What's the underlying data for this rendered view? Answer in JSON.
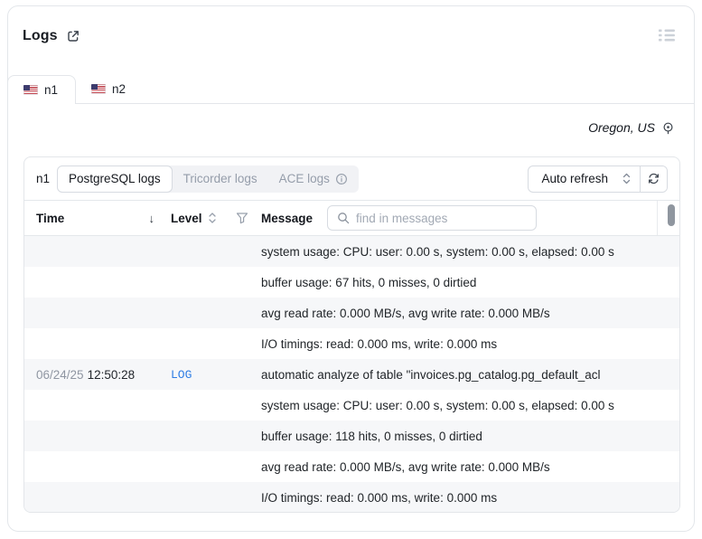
{
  "header": {
    "title": "Logs"
  },
  "node_tabs": [
    {
      "label": "n1",
      "active": true
    },
    {
      "label": "n2",
      "active": false
    }
  ],
  "region": {
    "label": "Oregon, US"
  },
  "toolbar": {
    "node_label": "n1",
    "log_tabs": [
      {
        "label": "PostgreSQL logs",
        "active": true
      },
      {
        "label": "Tricorder logs",
        "active": false
      },
      {
        "label": "ACE logs",
        "active": false,
        "has_info_icon": true
      }
    ],
    "auto_refresh_label": "Auto refresh"
  },
  "table": {
    "columns": {
      "time": "Time",
      "level": "Level",
      "message": "Message"
    },
    "search_placeholder": "find in messages",
    "rows": [
      {
        "date": "",
        "time": "",
        "level": "",
        "message": "system usage: CPU: user: 0.00 s, system: 0.00 s, elapsed: 0.00 s"
      },
      {
        "date": "",
        "time": "",
        "level": "",
        "message": "buffer usage: 67 hits, 0 misses, 0 dirtied"
      },
      {
        "date": "",
        "time": "",
        "level": "",
        "message": "avg read rate: 0.000 MB/s, avg write rate: 0.000 MB/s"
      },
      {
        "date": "",
        "time": "",
        "level": "",
        "message": "I/O timings: read: 0.000 ms, write: 0.000 ms"
      },
      {
        "date": "06/24/25",
        "time": "12:50:28",
        "level": "LOG",
        "message": "automatic analyze of table \"invoices.pg_catalog.pg_default_acl"
      },
      {
        "date": "",
        "time": "",
        "level": "",
        "message": "system usage: CPU: user: 0.00 s, system: 0.00 s, elapsed: 0.00 s"
      },
      {
        "date": "",
        "time": "",
        "level": "",
        "message": "buffer usage: 118 hits, 0 misses, 0 dirtied"
      },
      {
        "date": "",
        "time": "",
        "level": "",
        "message": "avg read rate: 0.000 MB/s, avg write rate: 0.000 MB/s"
      },
      {
        "date": "",
        "time": "",
        "level": "",
        "message": "I/O timings: read: 0.000 ms, write: 0.000 ms"
      }
    ]
  },
  "icons": {
    "sort_descending": "↓"
  },
  "colors": {
    "accent_blue": "#2e7de4",
    "stripe": "#f6f7f9",
    "border": "#e3e6ea",
    "muted_text": "#959daa"
  }
}
